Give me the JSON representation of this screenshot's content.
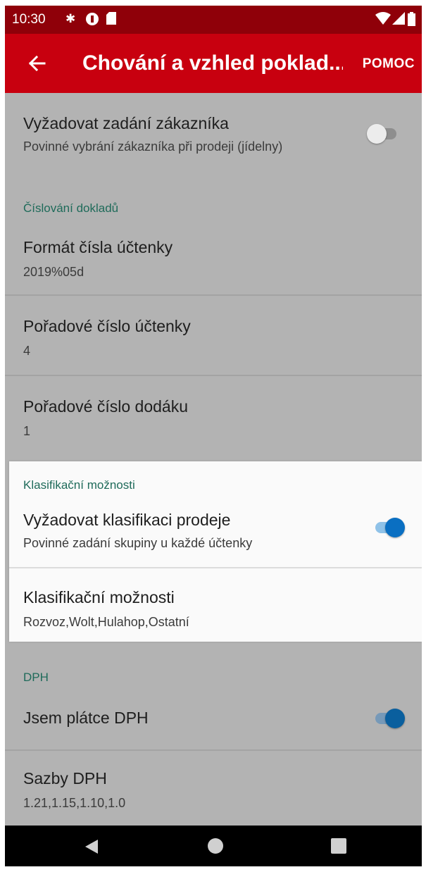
{
  "status": {
    "time": "10:30",
    "icons": [
      "bluetooth-icon",
      "data-saver-icon",
      "sd-card-icon",
      "wifi-icon",
      "signal-icon",
      "battery-icon"
    ]
  },
  "appbar": {
    "title": "Chování a vzhled poklad...",
    "help_label": "POMOC",
    "color": "#c8000f",
    "status_color": "#8f0009"
  },
  "settings": {
    "require_customer": {
      "title": "Vyžadovat zadání zákazníka",
      "summary": "Povinné vybrání zákazníka při prodeji (jídelny)",
      "enabled": false
    },
    "numbering_header": "Číslování dokladů",
    "receipt_format": {
      "title": "Formát čísla účtenky",
      "value": "2019%05d"
    },
    "receipt_seq": {
      "title": "Pořadové číslo účtenky",
      "value": "4"
    },
    "delivery_seq": {
      "title": "Pořadové číslo dodáku",
      "value": "1"
    },
    "classification_header": "Klasifikační možnosti",
    "require_classification": {
      "title": "Vyžadovat klasifikaci prodeje",
      "summary": "Povinné zadání skupiny u každé účtenky",
      "enabled": true
    },
    "classification_options": {
      "title": "Klasifikační možnosti",
      "value": "Rozvoz,Wolt,Hulahop,Ostatní"
    },
    "vat_header": "DPH",
    "vat_payer": {
      "title": "Jsem plátce DPH",
      "enabled": true
    },
    "vat_rates": {
      "title": "Sazby DPH",
      "value": "1.21,1.15,1.10,1.0"
    }
  },
  "colors": {
    "accent": "#0a6fc2",
    "category_text": "#1f6b5a"
  }
}
